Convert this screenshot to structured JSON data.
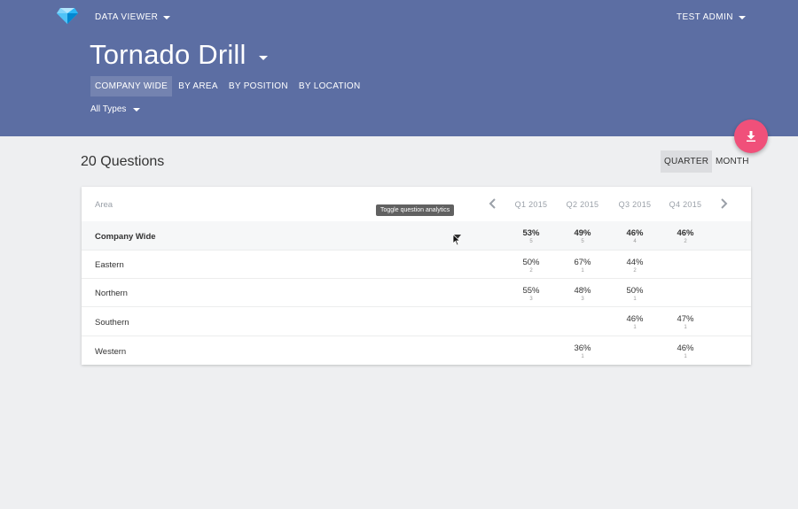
{
  "header": {
    "app_menu_label": "DATA VIEWER",
    "user_menu_label": "TEST ADMIN",
    "title": "Tornado Drill",
    "tabs": [
      {
        "label": "COMPANY WIDE",
        "active": true
      },
      {
        "label": "BY AREA",
        "active": false
      },
      {
        "label": "BY POSITION",
        "active": false
      },
      {
        "label": "BY LOCATION",
        "active": false
      }
    ],
    "type_filter": "All Types"
  },
  "fab": {
    "icon": "download-icon"
  },
  "summary": {
    "question_count": "20 Questions",
    "periods": [
      {
        "label": "QUARTER",
        "active": true
      },
      {
        "label": "MONTH",
        "active": false
      }
    ]
  },
  "table": {
    "area_header": "Area",
    "columns": [
      "Q1 2015",
      "Q2 2015",
      "Q3 2015",
      "Q4 2015"
    ],
    "rows": [
      {
        "area": "Company Wide",
        "cells": [
          {
            "pct": "53%",
            "n": "5"
          },
          {
            "pct": "49%",
            "n": "5"
          },
          {
            "pct": "46%",
            "n": "4"
          },
          {
            "pct": "46%",
            "n": "2"
          }
        ]
      },
      {
        "area": "Eastern",
        "cells": [
          {
            "pct": "50%",
            "n": "2"
          },
          {
            "pct": "67%",
            "n": "1"
          },
          {
            "pct": "44%",
            "n": "2"
          },
          {
            "pct": "",
            "n": ""
          }
        ]
      },
      {
        "area": "Northern",
        "cells": [
          {
            "pct": "55%",
            "n": "3"
          },
          {
            "pct": "48%",
            "n": "3"
          },
          {
            "pct": "50%",
            "n": "1"
          },
          {
            "pct": "",
            "n": ""
          }
        ]
      },
      {
        "area": "Southern",
        "cells": [
          {
            "pct": "",
            "n": ""
          },
          {
            "pct": "",
            "n": ""
          },
          {
            "pct": "46%",
            "n": "1"
          },
          {
            "pct": "47%",
            "n": "1"
          }
        ]
      },
      {
        "area": "Western",
        "cells": [
          {
            "pct": "",
            "n": ""
          },
          {
            "pct": "36%",
            "n": "1"
          },
          {
            "pct": "",
            "n": ""
          },
          {
            "pct": "46%",
            "n": "1"
          }
        ]
      }
    ]
  },
  "tooltip": {
    "text": "Toggle question analytics"
  },
  "colors": {
    "header_bg": "#5c6ea3",
    "fab": "#f0507a",
    "page_bg": "#eeeff1"
  }
}
